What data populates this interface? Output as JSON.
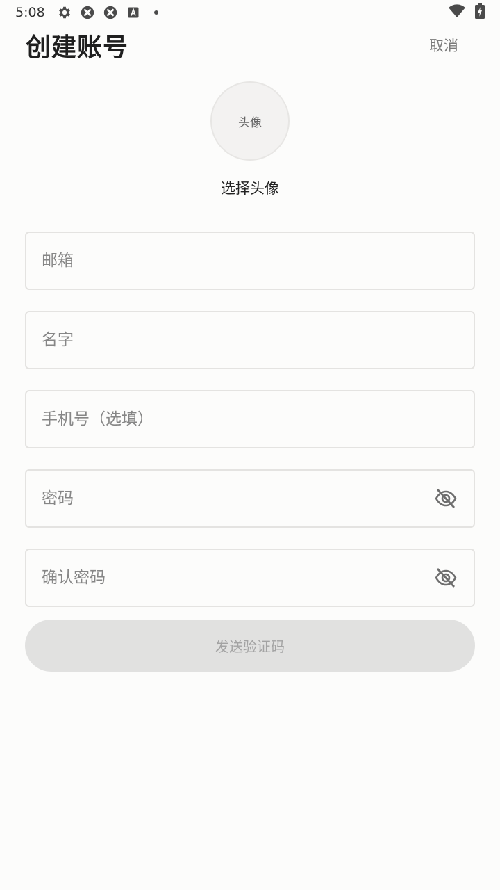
{
  "status_bar": {
    "time": "5:08",
    "icons": [
      "gear-icon",
      "app-icon",
      "app-icon",
      "keyboard-icon",
      "dot-icon"
    ],
    "right_icons": [
      "wifi-icon",
      "battery-charging-icon"
    ]
  },
  "header": {
    "title": "创建账号",
    "cancel_label": "取消"
  },
  "avatar": {
    "placeholder": "头像",
    "caption": "选择头像"
  },
  "form": {
    "email_placeholder": "邮箱",
    "name_placeholder": "名字",
    "phone_placeholder": "手机号（选填）",
    "password_placeholder": "密码",
    "confirm_password_placeholder": "确认密码",
    "submit_label": "发送验证码"
  },
  "colors": {
    "background": "#fcfcfb",
    "border": "#e4e3e1",
    "disabled_button": "#e1e1e0",
    "disabled_text": "#a3a3a3"
  }
}
